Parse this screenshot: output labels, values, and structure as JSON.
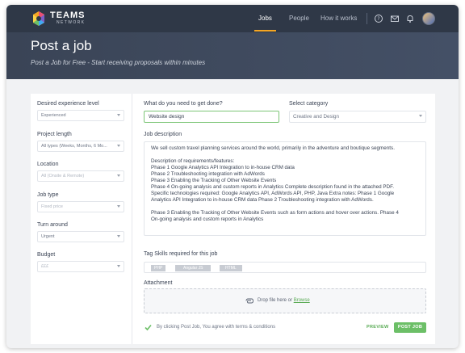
{
  "brand": {
    "name": "TEAMS",
    "sub": "NETWORK"
  },
  "nav": {
    "items": [
      {
        "label": "Jobs",
        "active": true
      },
      {
        "label": "People",
        "active": false
      },
      {
        "label": "How it works",
        "active": false
      }
    ],
    "icons": [
      "help-icon",
      "mail-icon",
      "bell-icon"
    ]
  },
  "hero": {
    "title": "Post a job",
    "subtitle": "Post a Job for Free - Start receiving proposals within minutes"
  },
  "filters": [
    {
      "label": "Desired experience level",
      "value": "Experienced",
      "dim": false
    },
    {
      "label": "Project length",
      "value": "All types (Weeks, Months, 6 Mo...",
      "dim": false
    },
    {
      "label": "Location",
      "value": "All  (Onsite & Remote)",
      "dim": true
    },
    {
      "label": "Job type",
      "value": "Fixed price",
      "dim": true
    },
    {
      "label": "Turn around",
      "value": "Urgent",
      "dim": false
    },
    {
      "label": "Budget",
      "value": "£££",
      "dim": true
    }
  ],
  "form": {
    "what_label": "What do you need to get done?",
    "what_value": "Website design",
    "category_label": "Select category",
    "category_value": "Creative and Design",
    "description_label": "Job description",
    "description_lines": [
      "We sell custom travel planning services around the world, primarily in the adventure and boutique segments.",
      "",
      "Description of requirements/features:",
      "Phase 1 Google Analytics API Integration to in-house CRM data",
      "Phase 2 Troubleshooting integration with AdWords",
      "Phase 3 Enabling the Tracking of Other Website Events",
      "Phase 4 On-going analysis and custom reports in Analytics Complete description found in the attached PDF.",
      "Specific technologies required: Google Analytics API, AdWords API, PHP, Java Extra notes: Phase 1 Google",
      "Analytics API Integration to in-house CRM data Phase 2 Troubleshooting integration with AdWords.",
      "",
      "Phase 3 Enabling the Tracking of Other Website Events such as form actions and hover over actions. Phase 4",
      "On-going analysis and custom reports in Analytics"
    ],
    "tags_label": "Tag Skills required for this job",
    "tags": [
      "PHP",
      "Angular JS",
      "HTML"
    ],
    "attachment_label": "Attachment",
    "drop_text": "Drop file here or ",
    "browse_text": "Browse",
    "agree_text": "By clicking Post Job, You agree with terms & conditions",
    "preview_label": "PREVIEW",
    "post_label": "POST JOB"
  },
  "colors": {
    "accent": "#6cbf67",
    "nav_bg": "#2f3847",
    "underline": "#f5a623"
  }
}
